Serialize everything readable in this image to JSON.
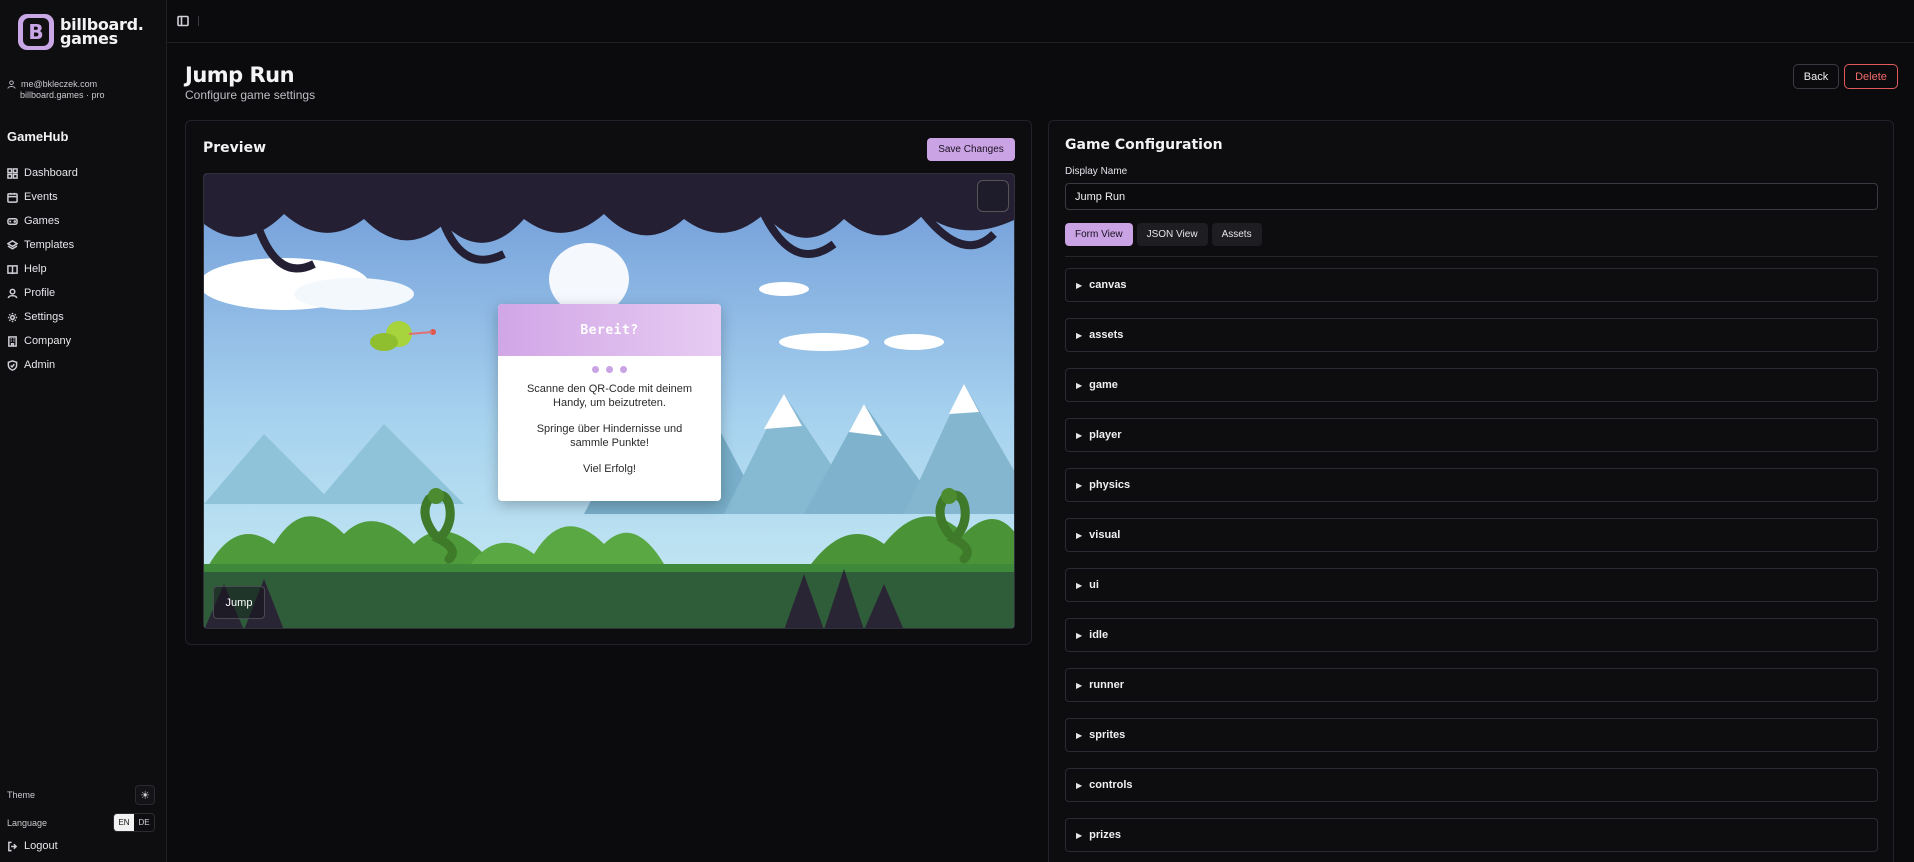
{
  "brand": {
    "name_line1": "billboard.",
    "name_line2": "games",
    "logo_letter": "B"
  },
  "user": {
    "email": "me@bkleczek.com",
    "account": "billboard.games · pro"
  },
  "sidebar": {
    "title": "GameHub",
    "items": [
      {
        "label": "Dashboard",
        "icon": "grid-icon"
      },
      {
        "label": "Events",
        "icon": "calendar-icon"
      },
      {
        "label": "Games",
        "icon": "gamepad-icon"
      },
      {
        "label": "Templates",
        "icon": "layers-icon"
      },
      {
        "label": "Help",
        "icon": "book-icon"
      },
      {
        "label": "Profile",
        "icon": "user-icon"
      },
      {
        "label": "Settings",
        "icon": "gear-icon"
      },
      {
        "label": "Company",
        "icon": "building-icon"
      },
      {
        "label": "Admin",
        "icon": "shield-icon"
      }
    ],
    "theme_label": "Theme",
    "language_label": "Language",
    "lang_en": "EN",
    "lang_de": "DE",
    "logout_label": "Logout"
  },
  "header": {
    "title": "Jump Run",
    "subtitle": "Configure game settings",
    "back_label": "Back",
    "delete_label": "Delete"
  },
  "preview": {
    "title": "Preview",
    "save_label": "Save Changes",
    "dialog": {
      "heading": "Bereit?",
      "line1": "Scanne den QR-Code mit deinem Handy, um beizutreten.",
      "line2": "Springe über Hindernisse und sammle Punkte!",
      "line3": "Viel Erfolg!"
    },
    "jump_label": "Jump"
  },
  "config": {
    "title": "Game Configuration",
    "display_name_label": "Display Name",
    "display_name_value": "Jump Run",
    "tabs": [
      "Form View",
      "JSON View",
      "Assets"
    ],
    "sections": [
      "canvas",
      "assets",
      "game",
      "player",
      "physics",
      "visual",
      "ui",
      "idle",
      "runner",
      "sprites",
      "controls",
      "prizes"
    ]
  },
  "colors": {
    "accent": "#c9a3e3",
    "danger": "#e05a5a",
    "background": "#0b0b0d"
  }
}
